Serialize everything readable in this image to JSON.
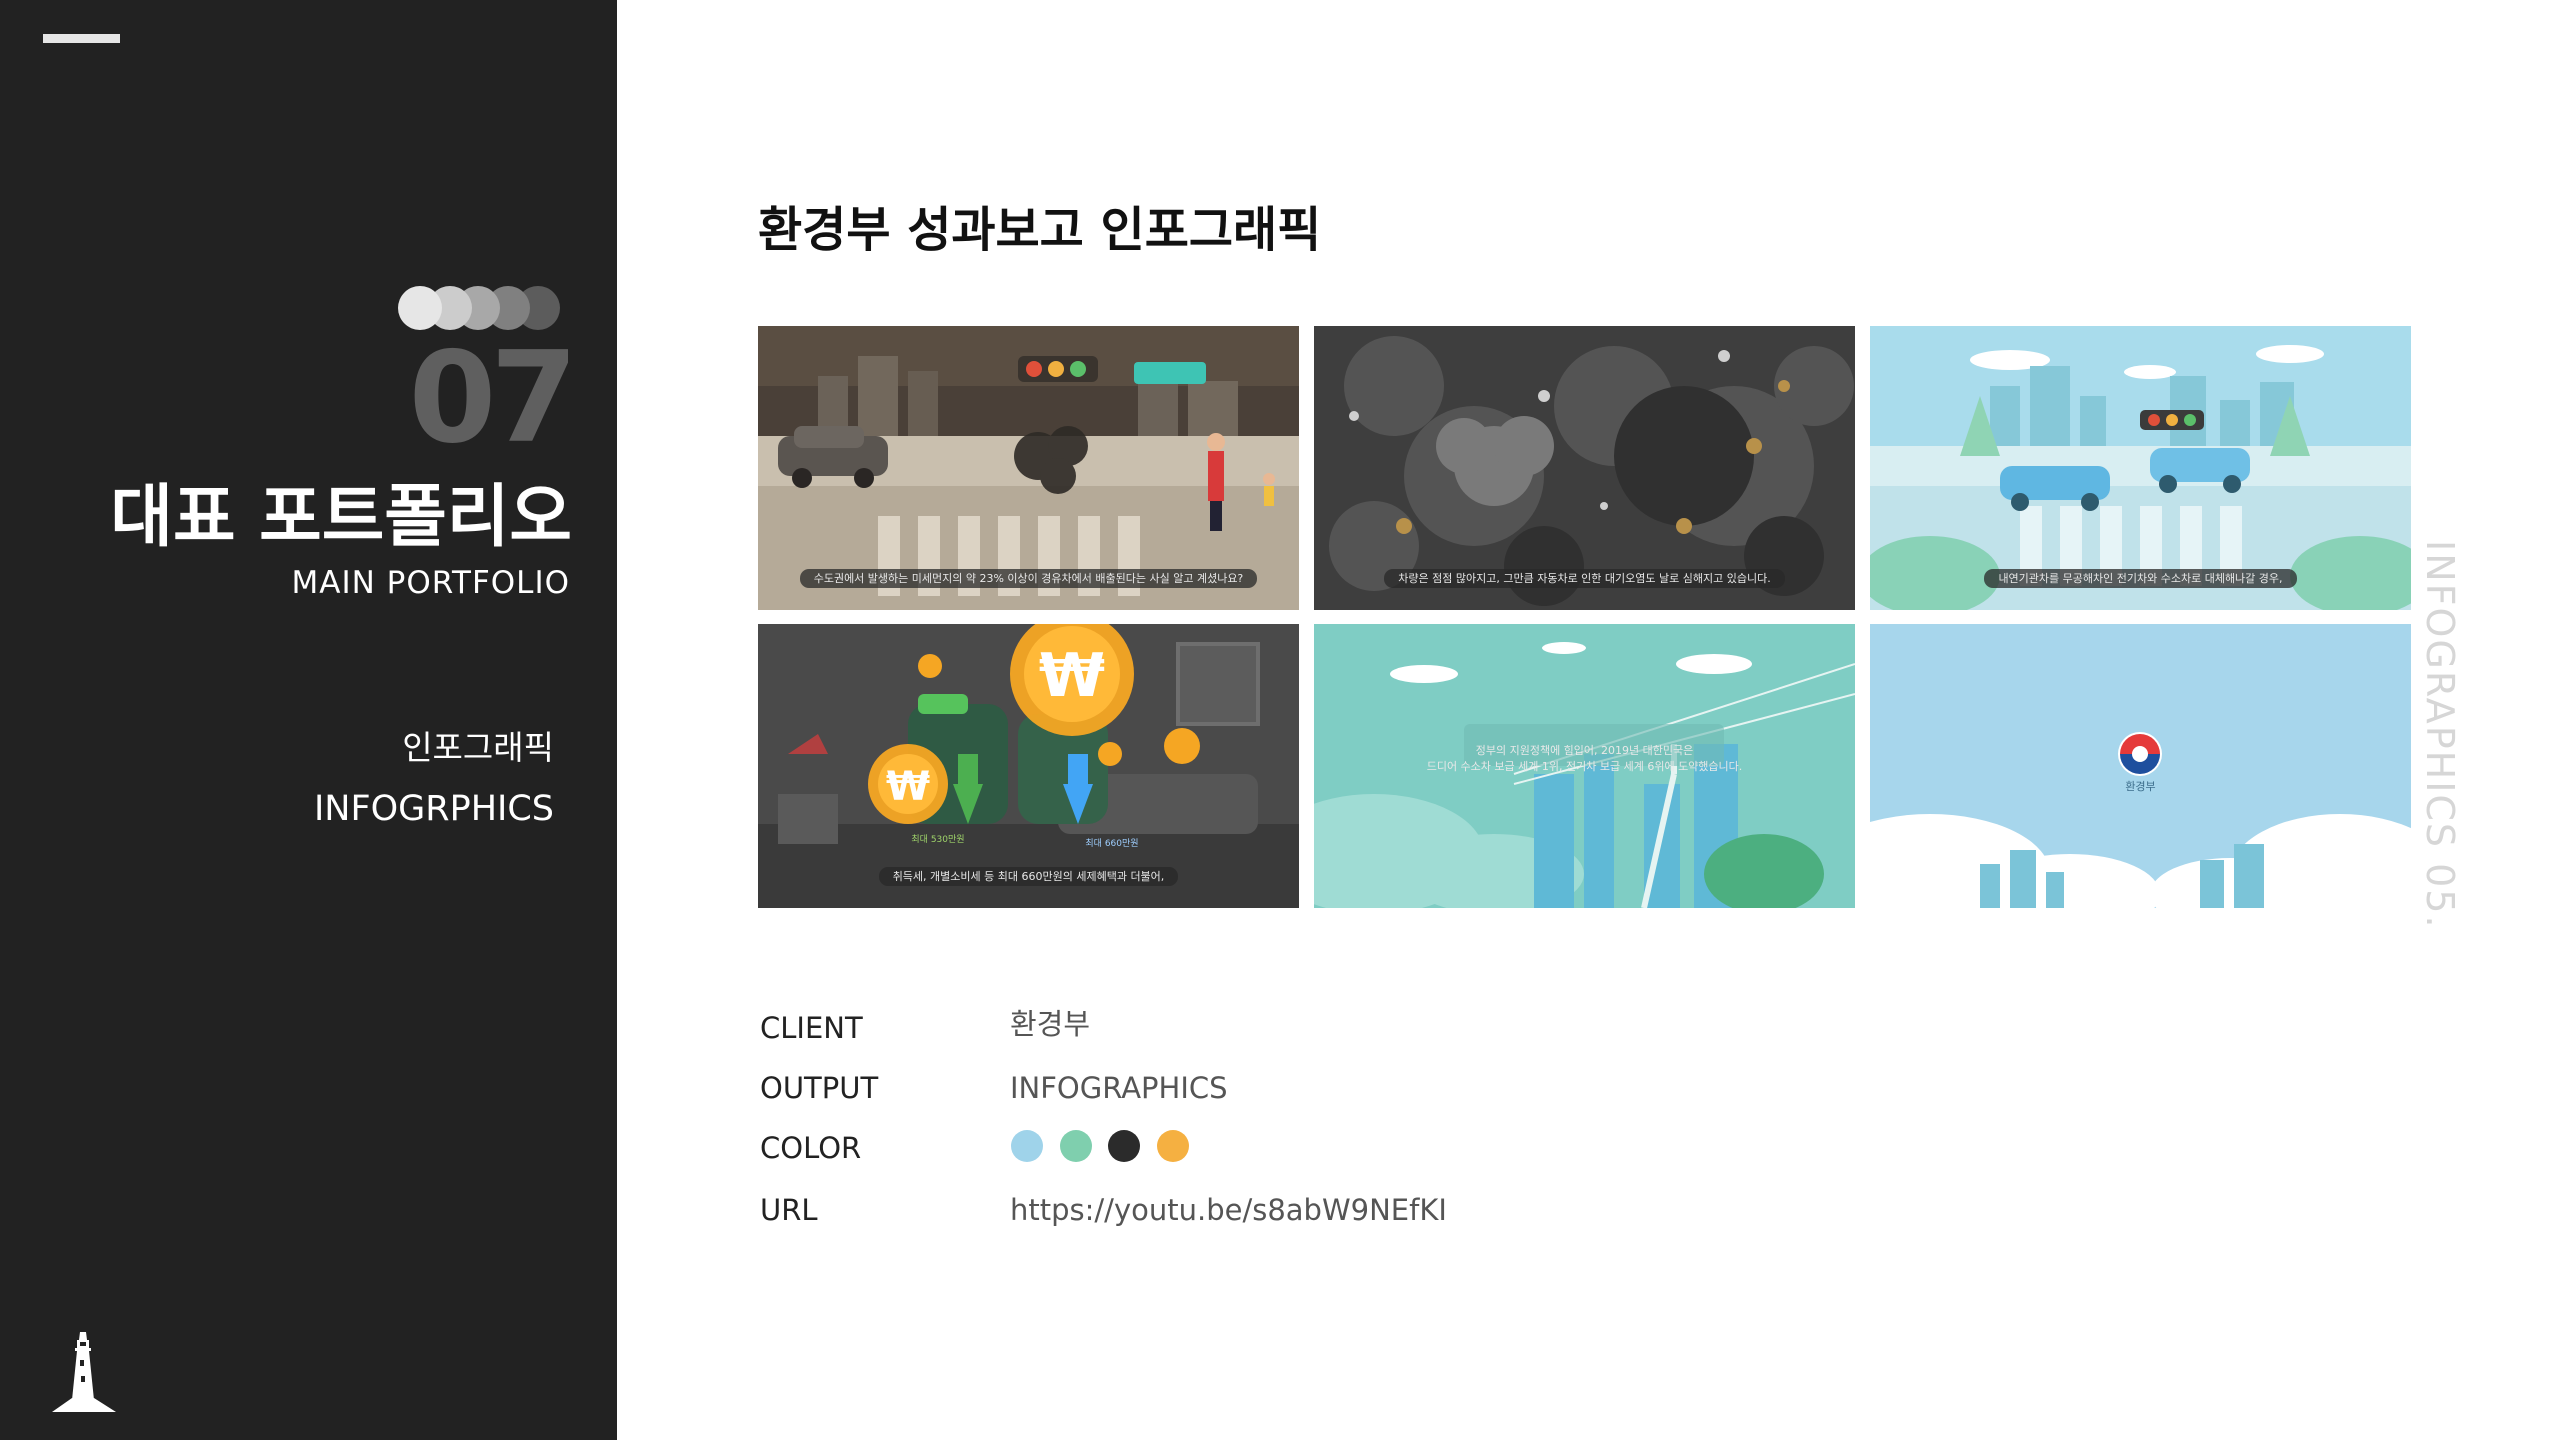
{
  "sidebar": {
    "number": "07",
    "title_ko": "대표 포트폴리오",
    "title_en": "MAIN PORTFOLIO",
    "category_ko": "인포그래픽",
    "category_en": "INFOGRPHICS",
    "dot_colors": [
      "#e6e6e6",
      "#cccccc",
      "#a8a8a8",
      "#808080",
      "#5c5c5c"
    ],
    "menu_icon": "hamburger-icon",
    "logo_icon": "lighthouse-icon"
  },
  "main": {
    "title": "환경부 성과보고 인포그래픽",
    "vertical_label": "INFOGRAPHICS  05.",
    "thumbnails": [
      {
        "caption": "수도권에서 발생하는 미세먼지의 약 23% 이상이 경유차에서 배출된다는 사실 알고 계셨나요?"
      },
      {
        "caption": "차량은 점점 많아지고, 그만큼 자동차로 인한 대기오염도 날로 심해지고 있습니다."
      },
      {
        "caption": "내연기관차를 무공해차인 전기차와 수소차로 대체해나갈 경우,"
      },
      {
        "caption": "취득세, 개별소비세 등 최대 660만원의 세제혜택과 더불어,",
        "label_left": "최대 530만원",
        "label_right": "최대 660만원",
        "coin_symbol": "₩"
      },
      {
        "caption": "정부의 지원정책에 힘입어, 2019년 대한민국은",
        "caption2": "드디어 수소차 보급 세계 1위, 전기차 보급 세계 6위에 도약했습니다."
      },
      {
        "caption": "환경부"
      }
    ],
    "info": {
      "client_label": "CLIENT",
      "client_value": "환경부",
      "output_label": "OUTPUT",
      "output_value": "INFOGRAPHICS",
      "color_label": "COLOR",
      "colors": [
        "#9fd3ea",
        "#7fcfae",
        "#2b2b2b",
        "#f5b041"
      ],
      "url_label": "URL",
      "url_value": "https://youtu.be/s8abW9NEfKI"
    }
  }
}
